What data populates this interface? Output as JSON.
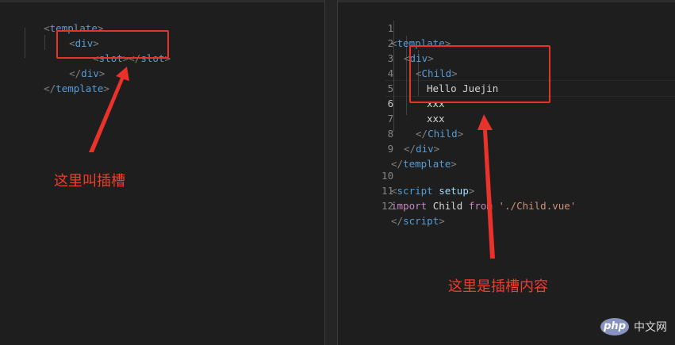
{
  "left_editor": {
    "lines": [
      {
        "tag_open": "<",
        "tag": "template",
        "tag_close": ">"
      },
      {
        "tag_open": "<",
        "tag": "div",
        "tag_close": ">"
      },
      {
        "tag_open": "<",
        "tag": "slot",
        "mid": "></",
        "tag2": "slot",
        "tag_close": ">"
      },
      {
        "tag_open": "</",
        "tag": "div",
        "tag_close": ">"
      },
      {
        "tag_open": "</",
        "tag": "template",
        "tag_close": ">"
      }
    ],
    "annotation": "这里叫插槽"
  },
  "right_editor": {
    "line_numbers": [
      "1",
      "2",
      "3",
      "4",
      "5",
      "6",
      "7",
      "8",
      "9",
      "10",
      "11",
      "12"
    ],
    "active_line": "6",
    "lines": [
      {
        "tag_open": "<",
        "tag": "template",
        "tag_close": ">"
      },
      {
        "tag_open": "<",
        "tag": "div",
        "tag_close": ">"
      },
      {
        "tag_open": "<",
        "tag": "Child",
        "tag_close": ">"
      },
      {
        "text": "Hello Juejin"
      },
      {
        "text": "xxx"
      },
      {
        "text": "xxx"
      },
      {
        "tag_open": "</",
        "tag": "Child",
        "tag_close": ">"
      },
      {
        "tag_open": "</",
        "tag": "div",
        "tag_close": ">"
      },
      {
        "tag_open": "</",
        "tag": "template",
        "tag_close": ">"
      },
      {
        "tag_open": "<",
        "tag": "script",
        "attr": "setup",
        "tag_close": ">"
      },
      {
        "kw1": "import",
        "ident": "Child",
        "kw2": "from",
        "str": "'./Child.vue'"
      },
      {
        "tag_open": "</",
        "tag": "script",
        "tag_close": ">"
      }
    ],
    "annotation": "这里是插槽内容"
  },
  "watermark": {
    "logo": "php",
    "text": "中文网"
  },
  "colors": {
    "annotation_red": "#e8322a",
    "tag_blue": "#569cd6",
    "keyword_purple": "#c586c0",
    "string_orange": "#ce9178",
    "attr_lightblue": "#9cdcfe"
  }
}
